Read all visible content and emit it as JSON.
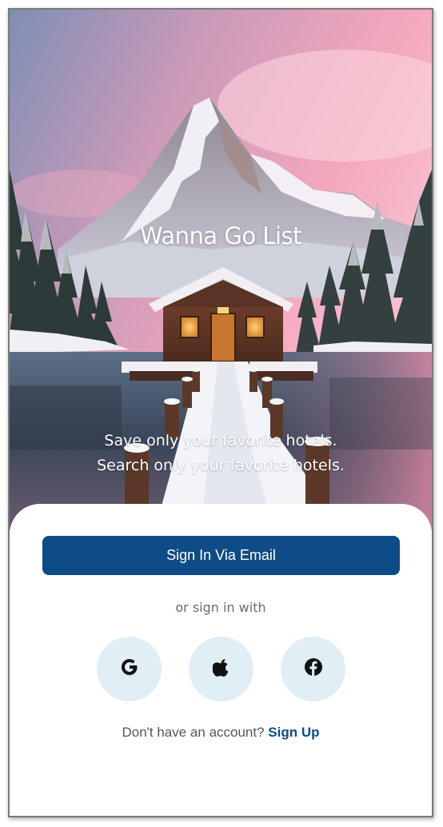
{
  "app": {
    "title": "Wanna Go List",
    "tagline_line1": "Save only your favorite hotels.",
    "tagline_line2": "Search only your favorite hotels."
  },
  "auth": {
    "email_button_label": "Sign In Via Email",
    "alt_sign_in_text": "or sign in with",
    "social": [
      {
        "provider": "Google",
        "icon": "google-icon"
      },
      {
        "provider": "Apple",
        "icon": "apple-icon"
      },
      {
        "provider": "Facebook",
        "icon": "facebook-icon"
      }
    ],
    "no_account_text": "Don't have an account?",
    "sign_up_label": "Sign Up"
  },
  "colors": {
    "primary": "#0e4c87",
    "social_bg": "#e0eef5",
    "sky_pink": "#f2a9bd",
    "muted_text": "#6b6b6b"
  }
}
